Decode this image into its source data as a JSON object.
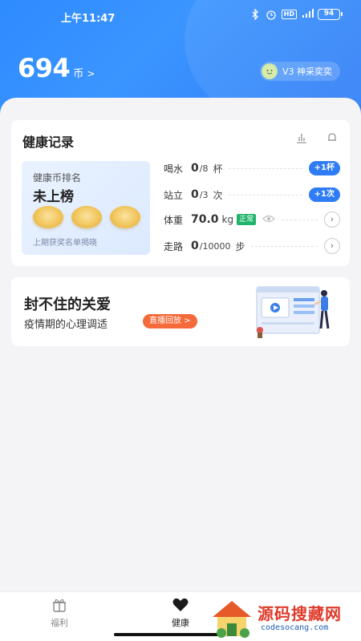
{
  "status_bar": {
    "time": "上午11:47",
    "battery": "94",
    "hd_label": "HD"
  },
  "header": {
    "coins": "694",
    "coin_unit": "币",
    "coin_arrow": ">",
    "vip_label": "V3 神采奕奕"
  },
  "health_card": {
    "title": "健康记录",
    "rank": {
      "label": "健康币排名",
      "value": "未上榜",
      "footer": "上期获奖名单揭晓"
    },
    "records": [
      {
        "name": "喝水",
        "value": "0",
        "total": "/8",
        "unit": "杯",
        "button": "+1杯"
      },
      {
        "name": "站立",
        "value": "0",
        "total": "/3",
        "unit": "次",
        "button": "+1次"
      },
      {
        "name": "体重",
        "value": "70.0",
        "unit": "kg",
        "badge": "正常"
      },
      {
        "name": "走路",
        "value": "0",
        "total": "/10000",
        "unit": "步"
      }
    ]
  },
  "banner": {
    "title": "封不住的关爱",
    "subtitle": "疫情期的心理调适",
    "button": "直播回放 >"
  },
  "tabbar": {
    "tabs": [
      {
        "label": "福利"
      },
      {
        "label": "健康"
      }
    ]
  },
  "watermark": {
    "text": "源码搜藏网",
    "url": "codesocang.com"
  },
  "colors": {
    "primary": "#2f7cf6",
    "accent_orange": "#f46a3a",
    "ok_green": "#1fb36b"
  }
}
